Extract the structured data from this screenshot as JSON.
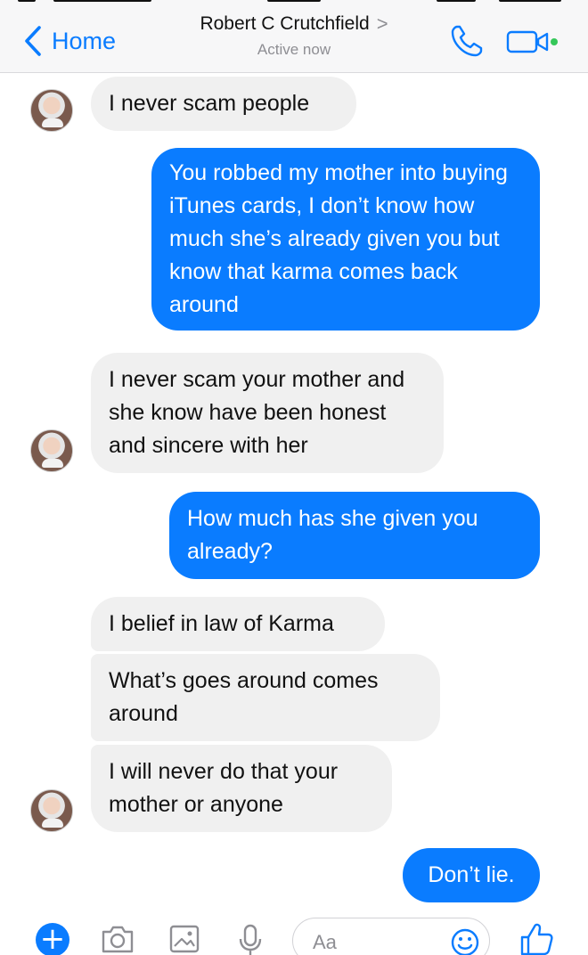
{
  "header": {
    "back_label": "Home",
    "contact_name": "Robert C Crutchfield",
    "contact_chevron": ">",
    "status": "Active now"
  },
  "messages": [
    {
      "side": "in",
      "text": "I never scam people"
    },
    {
      "side": "out",
      "text": "You robbed my mother into buying iTunes cards, I don’t know how much she’s already given you but know that karma comes back around"
    },
    {
      "side": "in",
      "text": "I never scam your mother and she know have been honest and sincere with her"
    },
    {
      "side": "out",
      "text": "How much has she given you already?"
    },
    {
      "side": "in",
      "text": "I belief in law of Karma"
    },
    {
      "side": "in",
      "text": "What’s goes around comes around"
    },
    {
      "side": "in",
      "text": "I will never do that your mother or anyone"
    },
    {
      "side": "out",
      "text": "Don’t lie."
    }
  ],
  "composer": {
    "plus_label": "+",
    "placeholder": "Aa"
  },
  "colors": {
    "accent": "#0a7cff",
    "incoming_bubble": "#f0f0f0",
    "online_dot": "#35c759"
  },
  "icons": [
    "chevron-left-icon",
    "phone-icon",
    "video-camera-icon",
    "plus-icon",
    "camera-icon",
    "image-icon",
    "microphone-icon",
    "emoji-icon",
    "thumbs-up-icon"
  ]
}
